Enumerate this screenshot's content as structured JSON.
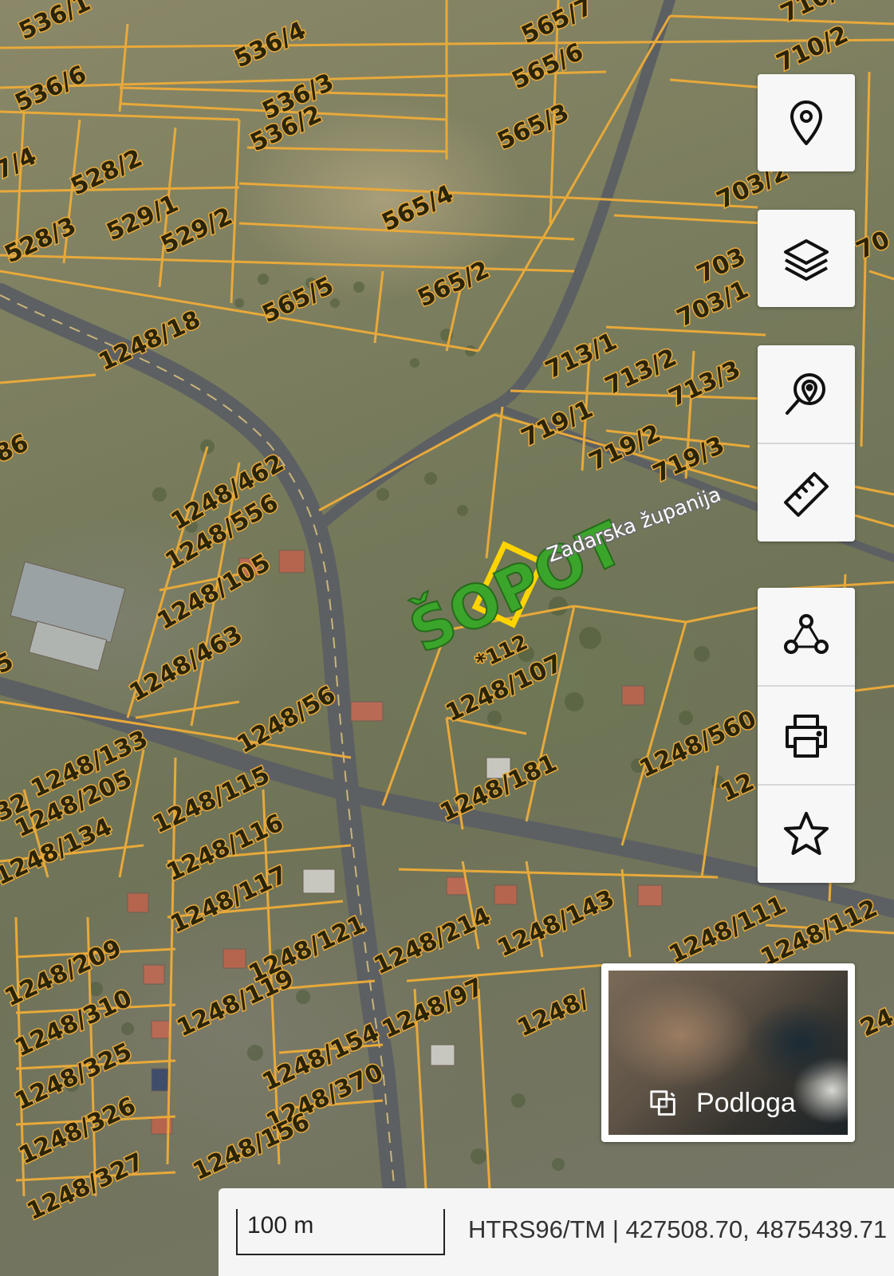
{
  "map": {
    "parcel_labels": [
      "536/1",
      "536/4",
      "536/6",
      "536/3",
      "536/2",
      "565/7",
      "565/6",
      "565/3",
      "710/",
      "710/2",
      "7/4",
      "528/2",
      "529/1",
      "529/2",
      "528/3",
      "565/4",
      "703/2",
      "565/5",
      "565/2",
      "703",
      "703/1",
      "70",
      "1248/18",
      "713/1",
      "713/2",
      "713/3",
      "719/1",
      "719/2",
      "719/3",
      "86",
      "1248/462",
      "1248/556",
      "1248/105",
      "1248/463",
      "*112",
      "1248/107",
      "1248/56",
      "1248/560",
      "1248/133",
      "1248/205",
      "1248/134",
      "1248/115",
      "1248/116",
      "1248/181",
      "1248/117",
      "1248/121",
      "1248/214",
      "1248/143",
      "1248/111",
      "1248/112",
      "1248/209",
      "1248/119",
      "1248/97",
      "1248/310",
      "1248/154",
      "1248/325",
      "1248/370",
      "1248/326",
      "1248/156",
      "1248/327",
      "1248/",
      "32",
      "5",
      "12",
      "24"
    ],
    "place_name": "ŠOPOT",
    "county_name": "Zadarska županija",
    "parcel_color": "#e8a93a",
    "highlight_color": "#ffd400",
    "place_color": "#3aa52a"
  },
  "controls": {
    "location": {
      "icon": "map-pin-icon"
    },
    "layers": {
      "icon": "layers-icon"
    },
    "search": {
      "icon": "search-location-icon"
    },
    "measure": {
      "icon": "ruler-icon"
    },
    "draw": {
      "icon": "polygon-icon"
    },
    "print": {
      "icon": "printer-icon"
    },
    "favorite": {
      "icon": "star-icon"
    }
  },
  "basemap": {
    "label": "Podloga",
    "icon": "basemap-switch-icon"
  },
  "status": {
    "scale": "100 m",
    "projection": "HTRS96/TM",
    "separator": " | ",
    "coordinates": "427508.70, 4875439.71"
  }
}
